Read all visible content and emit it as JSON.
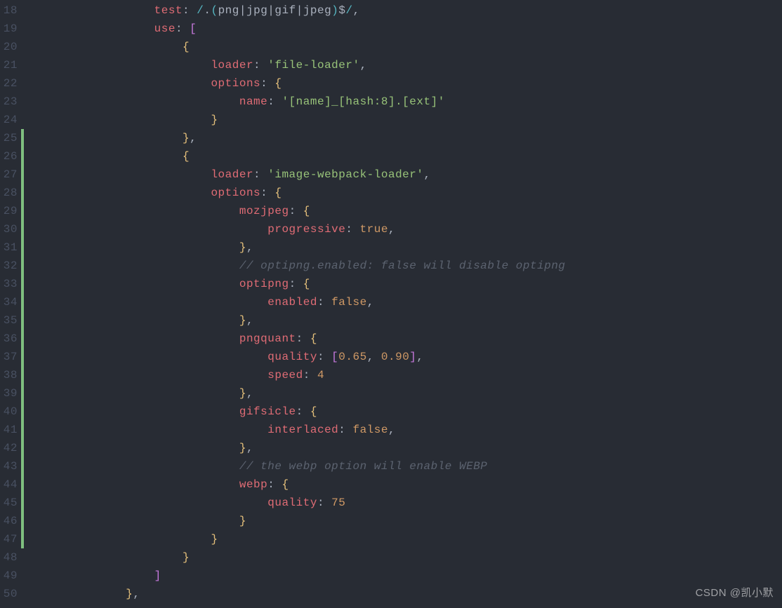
{
  "gutter": {
    "start": 18,
    "end": 50
  },
  "markers": [
    {
      "from": 25,
      "to": 47
    }
  ],
  "code": {
    "lines": [
      {
        "indent": 4,
        "tokens": [
          [
            "prop",
            "test"
          ],
          [
            "punc",
            ": "
          ],
          [
            "reg",
            "/"
          ],
          [
            "regbody",
            "."
          ],
          [
            "paren",
            "("
          ],
          [
            "regbody",
            "png"
          ],
          [
            "punc",
            "|"
          ],
          [
            "regbody",
            "jpg"
          ],
          [
            "punc",
            "|"
          ],
          [
            "regbody",
            "gif"
          ],
          [
            "punc",
            "|"
          ],
          [
            "regbody",
            "jpeg"
          ],
          [
            "paren",
            ")"
          ],
          [
            "regbody",
            "$"
          ],
          [
            "reg",
            "/"
          ],
          [
            "punc",
            ","
          ]
        ]
      },
      {
        "indent": 4,
        "tokens": [
          [
            "prop",
            "use"
          ],
          [
            "punc",
            ": "
          ],
          [
            "bracket",
            "["
          ]
        ]
      },
      {
        "indent": 5,
        "tokens": [
          [
            "brace",
            "{"
          ]
        ]
      },
      {
        "indent": 6,
        "tokens": [
          [
            "prop",
            "loader"
          ],
          [
            "punc",
            ": "
          ],
          [
            "str",
            "'file-loader'"
          ],
          [
            "punc",
            ","
          ]
        ]
      },
      {
        "indent": 6,
        "tokens": [
          [
            "prop",
            "options"
          ],
          [
            "punc",
            ": "
          ],
          [
            "brace",
            "{"
          ]
        ]
      },
      {
        "indent": 7,
        "tokens": [
          [
            "prop",
            "name"
          ],
          [
            "punc",
            ": "
          ],
          [
            "str",
            "'[name]_[hash:8].[ext]'"
          ]
        ]
      },
      {
        "indent": 6,
        "tokens": [
          [
            "brace",
            "}"
          ]
        ]
      },
      {
        "indent": 5,
        "tokens": [
          [
            "brace",
            "}"
          ],
          [
            "punc",
            ","
          ]
        ]
      },
      {
        "indent": 5,
        "tokens": [
          [
            "brace",
            "{"
          ]
        ]
      },
      {
        "indent": 6,
        "tokens": [
          [
            "prop",
            "loader"
          ],
          [
            "punc",
            ": "
          ],
          [
            "str",
            "'image-webpack-loader'"
          ],
          [
            "punc",
            ","
          ]
        ]
      },
      {
        "indent": 6,
        "tokens": [
          [
            "prop",
            "options"
          ],
          [
            "punc",
            ": "
          ],
          [
            "brace",
            "{"
          ]
        ]
      },
      {
        "indent": 7,
        "tokens": [
          [
            "prop",
            "mozjpeg"
          ],
          [
            "punc",
            ": "
          ],
          [
            "brace",
            "{"
          ]
        ]
      },
      {
        "indent": 8,
        "tokens": [
          [
            "prop",
            "progressive"
          ],
          [
            "punc",
            ": "
          ],
          [
            "bool",
            "true"
          ],
          [
            "punc",
            ","
          ]
        ]
      },
      {
        "indent": 7,
        "tokens": [
          [
            "brace",
            "}"
          ],
          [
            "punc",
            ","
          ]
        ]
      },
      {
        "indent": 7,
        "tokens": [
          [
            "com",
            "// optipng.enabled: false will disable optipng"
          ]
        ]
      },
      {
        "indent": 7,
        "tokens": [
          [
            "prop",
            "optipng"
          ],
          [
            "punc",
            ": "
          ],
          [
            "brace",
            "{"
          ]
        ]
      },
      {
        "indent": 8,
        "tokens": [
          [
            "prop",
            "enabled"
          ],
          [
            "punc",
            ": "
          ],
          [
            "bool",
            "false"
          ],
          [
            "punc",
            ","
          ]
        ]
      },
      {
        "indent": 7,
        "tokens": [
          [
            "brace",
            "}"
          ],
          [
            "punc",
            ","
          ]
        ]
      },
      {
        "indent": 7,
        "tokens": [
          [
            "prop",
            "pngquant"
          ],
          [
            "punc",
            ": "
          ],
          [
            "brace",
            "{"
          ]
        ]
      },
      {
        "indent": 8,
        "tokens": [
          [
            "prop",
            "quality"
          ],
          [
            "punc",
            ": "
          ],
          [
            "bracket",
            "["
          ],
          [
            "num",
            "0.65"
          ],
          [
            "punc",
            ", "
          ],
          [
            "num",
            "0.90"
          ],
          [
            "bracket",
            "]"
          ],
          [
            "punc",
            ","
          ]
        ]
      },
      {
        "indent": 8,
        "tokens": [
          [
            "prop",
            "speed"
          ],
          [
            "punc",
            ": "
          ],
          [
            "num",
            "4"
          ]
        ]
      },
      {
        "indent": 7,
        "tokens": [
          [
            "brace",
            "}"
          ],
          [
            "punc",
            ","
          ]
        ]
      },
      {
        "indent": 7,
        "tokens": [
          [
            "prop",
            "gifsicle"
          ],
          [
            "punc",
            ": "
          ],
          [
            "brace",
            "{"
          ]
        ]
      },
      {
        "indent": 8,
        "tokens": [
          [
            "prop",
            "interlaced"
          ],
          [
            "punc",
            ": "
          ],
          [
            "bool",
            "false"
          ],
          [
            "punc",
            ","
          ]
        ]
      },
      {
        "indent": 7,
        "tokens": [
          [
            "brace",
            "}"
          ],
          [
            "punc",
            ","
          ]
        ]
      },
      {
        "indent": 7,
        "tokens": [
          [
            "com",
            "// the webp option will enable WEBP"
          ]
        ]
      },
      {
        "indent": 7,
        "tokens": [
          [
            "prop",
            "webp"
          ],
          [
            "punc",
            ": "
          ],
          [
            "brace",
            "{"
          ]
        ]
      },
      {
        "indent": 8,
        "tokens": [
          [
            "prop",
            "quality"
          ],
          [
            "punc",
            ": "
          ],
          [
            "num",
            "75"
          ]
        ]
      },
      {
        "indent": 7,
        "tokens": [
          [
            "brace",
            "}"
          ]
        ]
      },
      {
        "indent": 6,
        "tokens": [
          [
            "brace",
            "}"
          ]
        ]
      },
      {
        "indent": 5,
        "tokens": [
          [
            "brace",
            "}"
          ]
        ]
      },
      {
        "indent": 4,
        "tokens": [
          [
            "bracket",
            "]"
          ]
        ]
      },
      {
        "indent": 3,
        "tokens": [
          [
            "brace",
            "}"
          ],
          [
            "punc",
            ","
          ]
        ]
      }
    ]
  },
  "watermark": "CSDN @凯小默"
}
